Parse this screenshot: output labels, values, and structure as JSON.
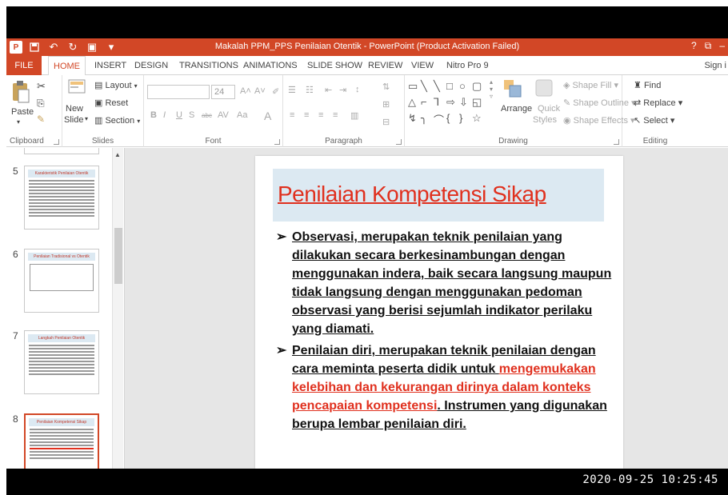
{
  "window": {
    "title": "Makalah PPM_PPS Penilaian Otentik - PowerPoint (Product Activation Failed)",
    "logo": "P",
    "controls": [
      "?",
      "⧉",
      "–"
    ]
  },
  "tabs": [
    "FILE",
    "HOME",
    "INSERT",
    "DESIGN",
    "TRANSITIONS",
    "ANIMATIONS",
    "SLIDE SHOW",
    "REVIEW",
    "VIEW",
    "Nitro Pro 9"
  ],
  "signin": "Sign i",
  "ribbon": {
    "clipboard": {
      "label": "Clipboard",
      "paste": "Paste"
    },
    "slides": {
      "label": "Slides",
      "new_slide_1": "New",
      "new_slide_2": "Slide",
      "layout": "Layout",
      "reset": "Reset",
      "section": "Section"
    },
    "font": {
      "label": "Font",
      "size": "24"
    },
    "paragraph": {
      "label": "Paragraph"
    },
    "drawing": {
      "label": "Drawing",
      "arrange": "Arrange",
      "quick_styles_1": "Quick",
      "quick_styles_2": "Styles",
      "shape_fill": "Shape Fill",
      "shape_outline": "Shape Outline",
      "shape_effects": "Shape Effects"
    },
    "editing": {
      "label": "Editing",
      "find": "Find",
      "replace": "Replace",
      "select": "Select"
    }
  },
  "slides_panel": {
    "items": [
      {
        "number": "5",
        "title": "Karakteristik Penilaian Otentik"
      },
      {
        "number": "6",
        "title": "Penilaian Tradisional vs Otentik"
      },
      {
        "number": "7",
        "title": "Langkah Penilaian Otentik"
      },
      {
        "number": "8",
        "title": "Penilaian Kompetensi Sikap"
      }
    ]
  },
  "slide": {
    "title": "Penilaian Kompetensi Sikap",
    "bullet1": "Observasi, merupakan teknik penilaian yang dilakukan secara berkesinambungan dengan menggunakan indera, baik secara langsung maupun tidak langsung dengan menggunakan pedoman observasi yang berisi sejumlah indikator perilaku yang diamati.",
    "bullet2_a": "Penilaian diri, merupakan teknik penilaian dengan cara meminta peserta didik untuk ",
    "bullet2_red": "mengemukakan kelebihan dan kekurangan dirinya dalam konteks pencapaian kompetensi",
    "bullet2_b": ". Instrumen yang digunakan berupa lembar penilaian diri."
  },
  "timestamp": "2020-09-25 10:25:45",
  "colors": {
    "accent": "#d24726",
    "title_red": "#e0301e",
    "title_bg": "#dce9f2"
  }
}
